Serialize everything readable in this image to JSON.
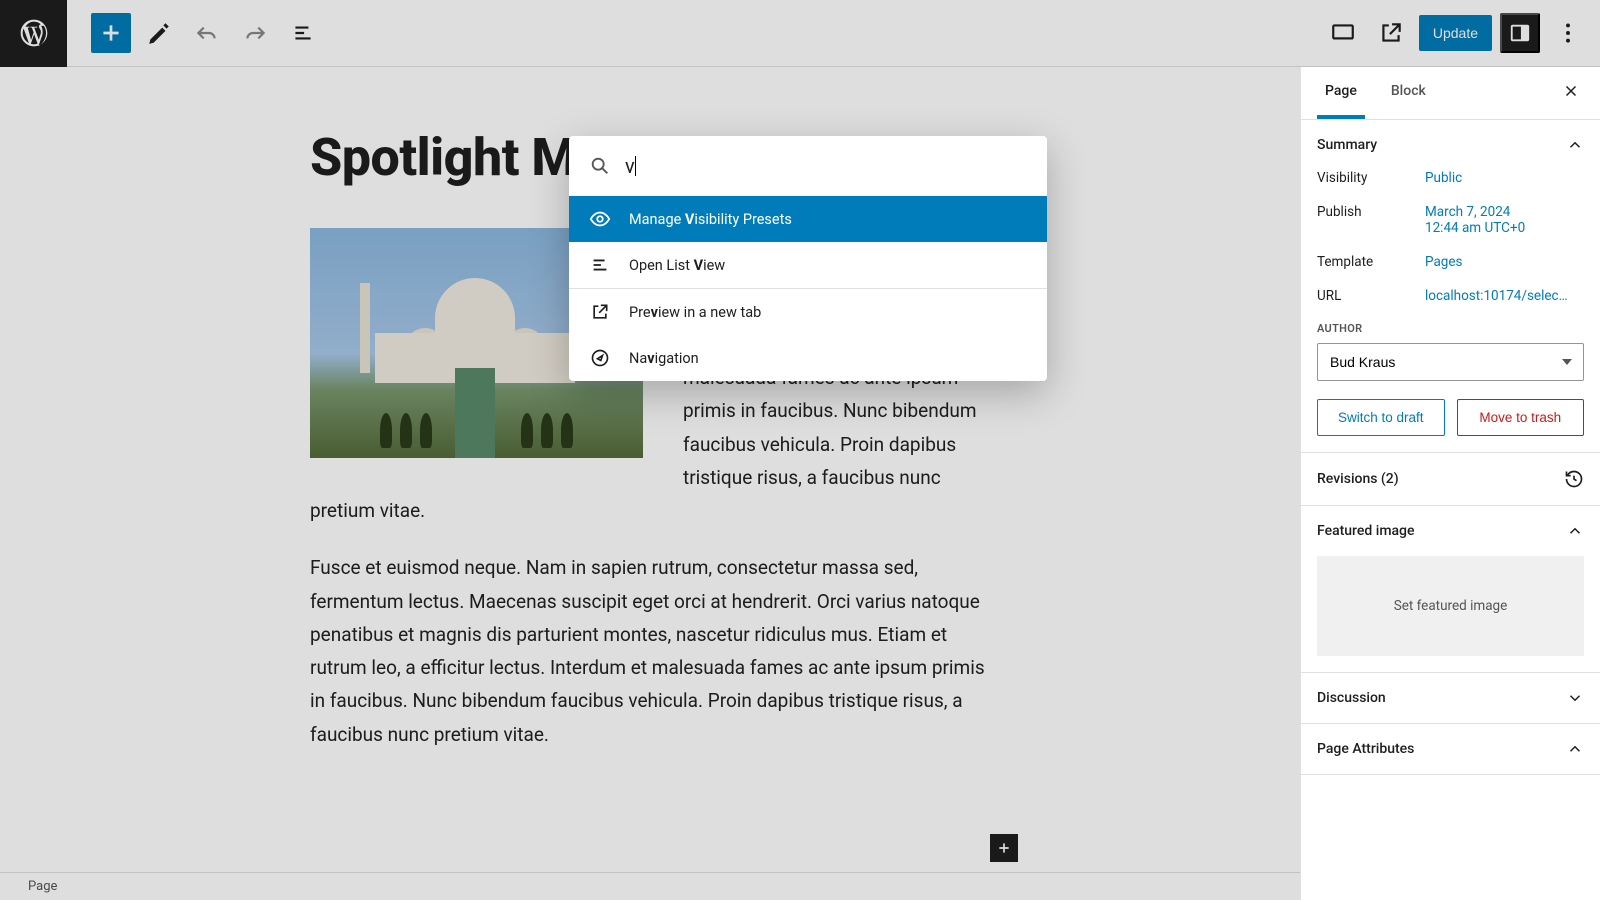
{
  "toolbar": {
    "update_label": "Update"
  },
  "editor": {
    "title": "Spotlight Mode",
    "paragraph1": "varius natoque penatibus et magnis dis parturient montes, nascetur ridiculus mus. Etiam et rutrum leo, a efficitur lectus. Interdum et malesuada fames ac ante ipsum primis in faucibus. Nunc bibendum faucibus vehicula. Proin dapibus tristique risus, a faucibus nunc pretium vitae.",
    "paragraph2": "Fusce et euismod neque. Nam in sapien rutrum, consectetur massa sed, fermentum lectus. Maecenas suscipit eget orci at hendrerit. Orci varius natoque penatibus et magnis dis parturient montes, nascetur ridiculus mus. Etiam et rutrum leo, a efficitur lectus. Interdum et malesuada fames ac ante ipsum primis in faucibus. Nunc bibendum faucibus vehicula. Proin dapibus tristique risus, a faucibus nunc pretium vitae."
  },
  "footer": {
    "breadcrumb": "Page"
  },
  "sidebar": {
    "tabs": {
      "page": "Page",
      "block": "Block"
    },
    "summary": {
      "heading": "Summary",
      "visibility_label": "Visibility",
      "visibility_value": "Public",
      "publish_label": "Publish",
      "publish_date": "March 7, 2024",
      "publish_time": "12:44 am UTC+0",
      "template_label": "Template",
      "template_value": "Pages",
      "url_label": "URL",
      "url_value": "localhost:10174/selec…",
      "author_label": "AUTHOR",
      "author_value": "Bud Kraus",
      "switch_draft": "Switch to draft",
      "move_trash": "Move to trash"
    },
    "revisions": "Revisions (2)",
    "featured": {
      "heading": "Featured image",
      "placeholder": "Set featured image"
    },
    "discussion": "Discussion",
    "page_attrs": "Page Attributes"
  },
  "palette": {
    "query": "v",
    "items": [
      {
        "pre": "Manage ",
        "hi": "V",
        "post": "isibility Presets"
      },
      {
        "pre": "Open List ",
        "hi": "V",
        "post": "iew"
      },
      {
        "pre": "Pre",
        "hi": "v",
        "post": "iew in a new tab"
      },
      {
        "pre": "Na",
        "hi": "v",
        "post": "igation"
      }
    ]
  }
}
